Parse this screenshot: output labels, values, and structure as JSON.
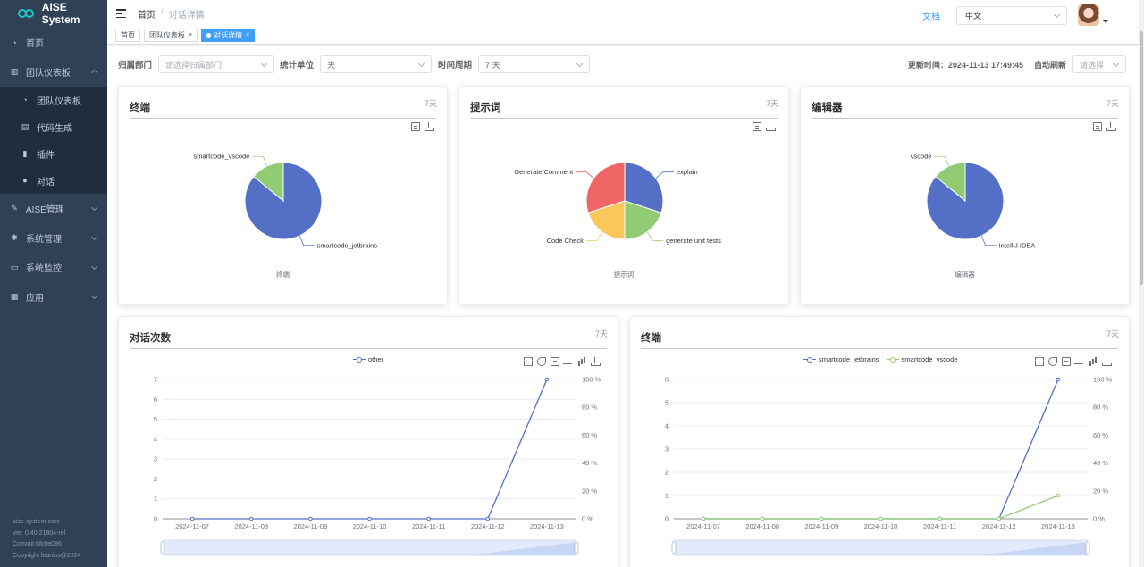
{
  "app": {
    "name": "AISE System"
  },
  "sidebar": {
    "items": [
      {
        "label": "首页",
        "icon": "dashboard-icon"
      },
      {
        "label": "团队仪表板",
        "icon": "chart-icon",
        "expanded": true,
        "children": [
          {
            "label": "团队仪表板",
            "icon": "dashboard-icon"
          },
          {
            "label": "代码生成",
            "icon": "code-icon"
          },
          {
            "label": "插件",
            "icon": "plugin-icon"
          },
          {
            "label": "对话",
            "icon": "chat-icon"
          }
        ]
      },
      {
        "label": "AISE管理",
        "icon": "tool-icon"
      },
      {
        "label": "系统管理",
        "icon": "gear-icon"
      },
      {
        "label": "系统监控",
        "icon": "monitor-icon"
      },
      {
        "label": "应用",
        "icon": "app-icon"
      }
    ],
    "footer": [
      "aise-system-core",
      "Ver. 0.40.21804-rel",
      "Commit:6fc0e096",
      "Copyright leaniss@2024"
    ]
  },
  "header": {
    "breadcrumb": [
      "首页",
      "对话详情"
    ],
    "docs_label": "文档",
    "language": "中文"
  },
  "tags": [
    {
      "label": "首页",
      "active": false
    },
    {
      "label": "团队仪表板",
      "active": false
    },
    {
      "label": "对话详情",
      "active": true
    }
  ],
  "filters": {
    "dept_label": "归属部门",
    "dept_placeholder": "请选择归属部门",
    "unit_label": "统计单位",
    "unit_value": "天",
    "period_label": "时间周期",
    "period_value": "7 天",
    "updated": "更新时间：2024-11-13 17:49:45",
    "auto_label": "自动刷新",
    "auto_placeholder": "请选择"
  },
  "cards": {
    "terminal_pie": {
      "title": "终端",
      "range": "7天",
      "caption": "终端"
    },
    "prompt_pie": {
      "title": "提示词",
      "range": "7天",
      "caption": "提示词"
    },
    "editor_pie": {
      "title": "编辑器",
      "range": "7天",
      "caption": "编辑器"
    },
    "conv_line": {
      "title": "对话次数",
      "range": "7天"
    },
    "terminal_line": {
      "title": "终端",
      "range": "7天"
    }
  },
  "chart_data": [
    {
      "type": "pie",
      "title": "终端",
      "slices": [
        {
          "name": "smartcode_jetbrains",
          "value": 86,
          "color": "#5470c6"
        },
        {
          "name": "smartcode_vscode",
          "value": 14,
          "color": "#91cc75"
        }
      ]
    },
    {
      "type": "pie",
      "title": "提示词",
      "slices": [
        {
          "name": "explain",
          "value": 30,
          "color": "#5470c6"
        },
        {
          "name": "generate unit tests",
          "value": 20,
          "color": "#91cc75"
        },
        {
          "name": "Code Check",
          "value": 20,
          "color": "#fac858"
        },
        {
          "name": "Generate Comment",
          "value": 30,
          "color": "#ee6666"
        }
      ]
    },
    {
      "type": "pie",
      "title": "编辑器",
      "slices": [
        {
          "name": "IntelliJ IDEA",
          "value": 86,
          "color": "#5470c6"
        },
        {
          "name": "vscode",
          "value": 14,
          "color": "#91cc75"
        }
      ]
    },
    {
      "type": "line",
      "title": "对话次数",
      "x": [
        "2024-11-07",
        "2024-11-08",
        "2024-11-09",
        "2024-11-10",
        "2024-11-11",
        "2024-11-12",
        "2024-11-13"
      ],
      "ylim": [
        0,
        7
      ],
      "yticks": [
        0,
        1,
        2,
        3,
        4,
        5,
        6,
        7
      ],
      "y2ticks": [
        "0 %",
        "20 %",
        "40 %",
        "60 %",
        "80 %",
        "100 %"
      ],
      "series": [
        {
          "name": "other",
          "values": [
            0,
            0,
            0,
            0,
            0,
            0,
            7
          ],
          "color": "#5470c6"
        }
      ]
    },
    {
      "type": "line",
      "title": "终端",
      "x": [
        "2024-11-07",
        "2024-11-08",
        "2024-11-09",
        "2024-11-10",
        "2024-11-11",
        "2024-11-12",
        "2024-11-13"
      ],
      "ylim": [
        0,
        6
      ],
      "yticks": [
        0,
        1,
        2,
        3,
        4,
        5,
        6
      ],
      "y2ticks": [
        "0 %",
        "20 %",
        "40 %",
        "60 %",
        "80 %",
        "100 %"
      ],
      "series": [
        {
          "name": "smartcode_jetbrains",
          "values": [
            0,
            0,
            0,
            0,
            0,
            0,
            6
          ],
          "color": "#5470c6"
        },
        {
          "name": "smartcode_vscode",
          "values": [
            0,
            0,
            0,
            0,
            0,
            0,
            1
          ],
          "color": "#91cc75"
        }
      ]
    }
  ]
}
